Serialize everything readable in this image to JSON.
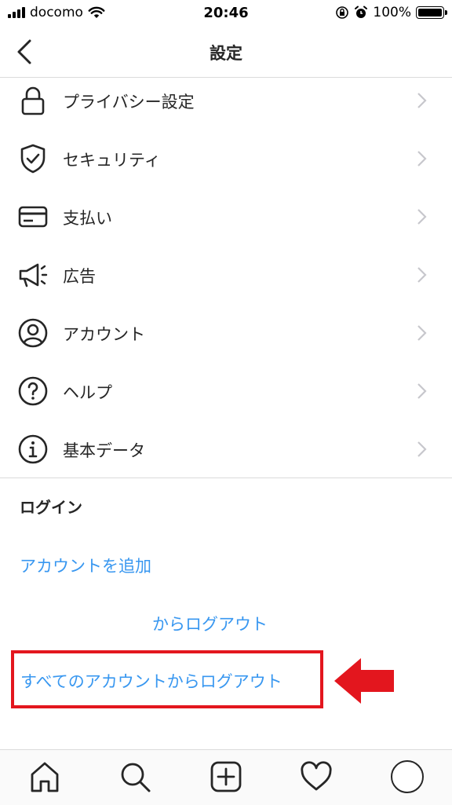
{
  "status_bar": {
    "carrier": "docomo",
    "time": "20:46",
    "battery": "100%"
  },
  "header": {
    "title": "設定"
  },
  "menu": [
    {
      "label": "プライバシー設定",
      "icon": "lock-icon"
    },
    {
      "label": "セキュリティ",
      "icon": "shield-check-icon"
    },
    {
      "label": "支払い",
      "icon": "credit-card-icon"
    },
    {
      "label": "広告",
      "icon": "megaphone-icon"
    },
    {
      "label": "アカウント",
      "icon": "account-circle-icon"
    },
    {
      "label": "ヘルプ",
      "icon": "help-circle-icon"
    },
    {
      "label": "基本データ",
      "icon": "info-circle-icon"
    }
  ],
  "login": {
    "section_title": "ログイン",
    "add_account": "アカウントを追加",
    "logout_user": "からログアウト",
    "logout_all": "すべてのアカウントからログアウト"
  },
  "tabs": [
    "home-icon",
    "search-icon",
    "add-post-icon",
    "heart-icon",
    "profile-avatar"
  ],
  "colors": {
    "link": "#3897f0",
    "highlight": "#e3161e",
    "text": "#262626"
  }
}
